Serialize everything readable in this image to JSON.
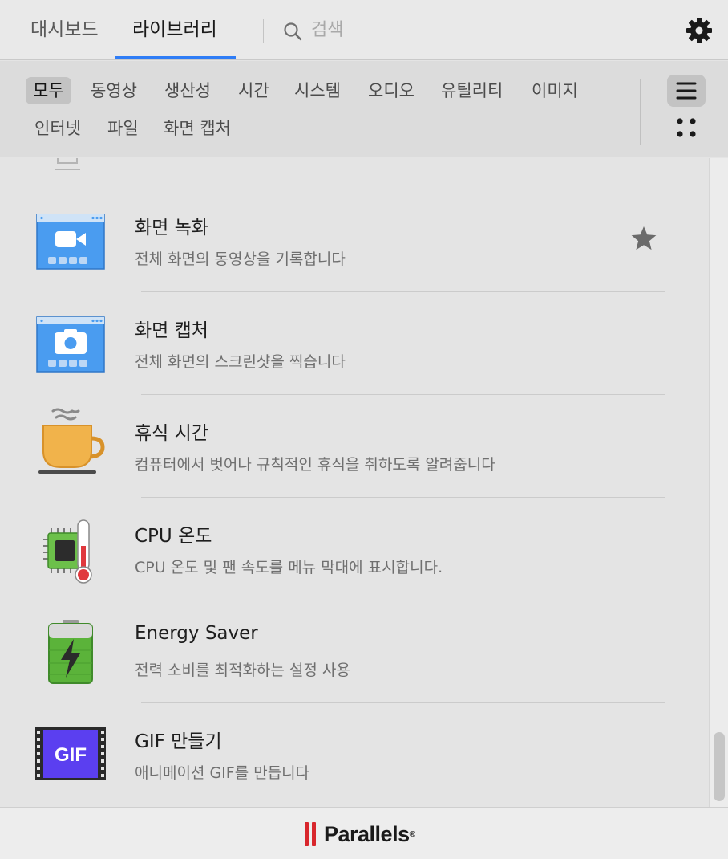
{
  "header": {
    "tabs": [
      {
        "label": "대시보드",
        "active": false
      },
      {
        "label": "라이브러리",
        "active": true
      }
    ],
    "search_placeholder": "검색",
    "accent_color": "#2f7df6"
  },
  "categories": [
    {
      "label": "모두",
      "active": true
    },
    {
      "label": "동영상",
      "active": false
    },
    {
      "label": "생산성",
      "active": false
    },
    {
      "label": "시간",
      "active": false
    },
    {
      "label": "시스템",
      "active": false
    },
    {
      "label": "오디오",
      "active": false
    },
    {
      "label": "유틸리티",
      "active": false
    },
    {
      "label": "이미지",
      "active": false
    },
    {
      "label": "인터넷",
      "active": false
    },
    {
      "label": "파일",
      "active": false
    },
    {
      "label": "화면 캡처",
      "active": false
    }
  ],
  "view_mode": "list",
  "items": [
    {
      "title": "화면 녹화",
      "desc": "전체 화면의 동영상을 기록합니다",
      "icon": "screen-record-icon",
      "favorite": true
    },
    {
      "title": "화면 캡처",
      "desc": "전체 화면의 스크린샷을 찍습니다",
      "icon": "screen-capture-icon",
      "favorite": false
    },
    {
      "title": "휴식 시간",
      "desc": "컴퓨터에서 벗어나 규칙적인 휴식을 취하도록 알려줍니다",
      "icon": "coffee-cup-icon",
      "favorite": false
    },
    {
      "title": "CPU 온도",
      "desc": "CPU 온도 및 팬 속도를 메뉴 막대에 표시합니다.",
      "icon": "cpu-thermometer-icon",
      "favorite": false
    },
    {
      "title": "Energy Saver",
      "desc": "전력 소비를 최적화하는 설정 사용",
      "icon": "battery-icon",
      "favorite": false
    },
    {
      "title": "GIF 만들기",
      "desc": "애니메이션 GIF를 만듭니다",
      "icon": "gif-film-icon",
      "favorite": false
    }
  ],
  "gif_icon_label": "GIF",
  "footer": {
    "brand": "Parallels",
    "brand_mark": "®",
    "brand_color": "#d8262c"
  }
}
